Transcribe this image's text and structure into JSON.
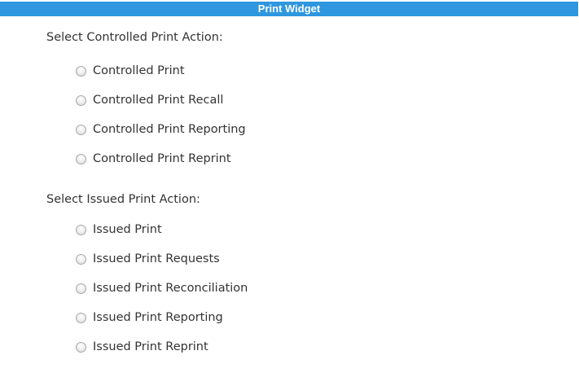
{
  "header": {
    "title": "Print Widget"
  },
  "controlled": {
    "label": "Select Controlled Print Action:",
    "options": [
      {
        "label": "Controlled Print"
      },
      {
        "label": "Controlled Print Recall"
      },
      {
        "label": "Controlled Print Reporting"
      },
      {
        "label": "Controlled Print Reprint"
      }
    ]
  },
  "issued": {
    "label": "Select Issued Print Action:",
    "options": [
      {
        "label": "Issued Print"
      },
      {
        "label": "Issued Print Requests"
      },
      {
        "label": "Issued Print Reconciliation"
      },
      {
        "label": "Issued Print Reporting"
      },
      {
        "label": "Issued Print Reprint"
      }
    ]
  },
  "colors": {
    "header_bg": "#2e97df",
    "header_text": "#ffffff",
    "text": "#333333"
  }
}
